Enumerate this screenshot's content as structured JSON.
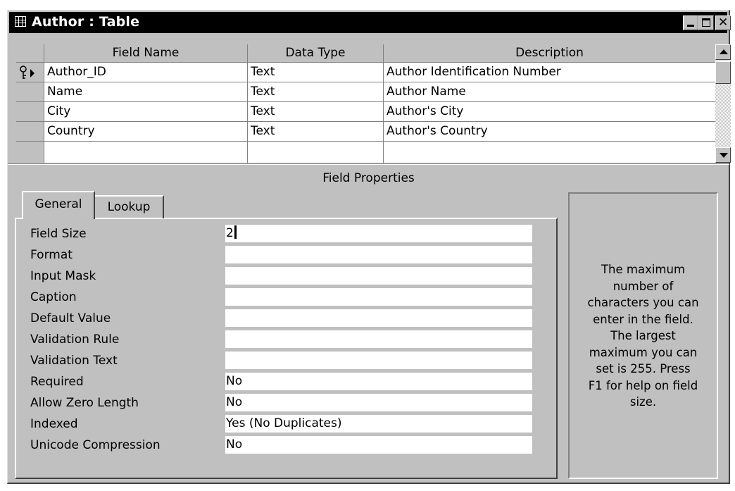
{
  "window": {
    "title": "Author : Table",
    "icon": "table-icon",
    "buttons": {
      "minimize": "minimize-icon",
      "maximize": "maximize-icon",
      "close": "close-icon"
    }
  },
  "grid": {
    "headers": {
      "field_name": "Field Name",
      "data_type": "Data Type",
      "description": "Description"
    },
    "rows": [
      {
        "field_name": "Author_ID",
        "data_type": "Text",
        "description": "Author Identification Number",
        "primary_key": true
      },
      {
        "field_name": "Name",
        "data_type": "Text",
        "description": "Author Name"
      },
      {
        "field_name": "City",
        "data_type": "Text",
        "description": "Author's City"
      },
      {
        "field_name": "Country",
        "data_type": "Text",
        "description": "Author's Country"
      }
    ]
  },
  "field_properties": {
    "caption": "Field Properties",
    "tabs": {
      "general": "General",
      "lookup": "Lookup"
    },
    "properties": [
      {
        "label": "Field Size",
        "value": "2"
      },
      {
        "label": "Format",
        "value": ""
      },
      {
        "label": "Input Mask",
        "value": ""
      },
      {
        "label": "Caption",
        "value": ""
      },
      {
        "label": "Default Value",
        "value": ""
      },
      {
        "label": "Validation Rule",
        "value": ""
      },
      {
        "label": "Validation Text",
        "value": ""
      },
      {
        "label": "Required",
        "value": "No"
      },
      {
        "label": "Allow Zero Length",
        "value": "No"
      },
      {
        "label": "Indexed",
        "value": "Yes (No Duplicates)"
      },
      {
        "label": "Unicode Compression",
        "value": "No"
      }
    ],
    "help_lines": [
      "The maximum",
      "number of",
      "characters you can",
      "enter in the field.",
      "The largest",
      "maximum you can",
      "set is 255.  Press",
      "F1 for help on field",
      "size."
    ]
  },
  "colors": {
    "face": "#c0c0c0",
    "title_bar": "#000000",
    "shadow": "#808080",
    "highlight": "#ffffff"
  }
}
